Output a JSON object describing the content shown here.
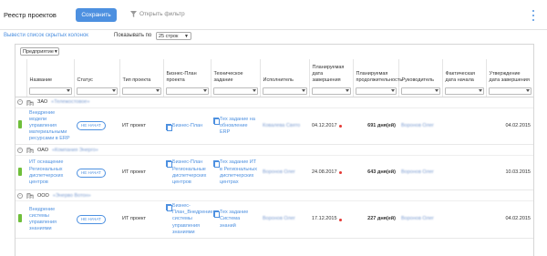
{
  "header": {
    "title": "Реестр проектов",
    "save_label": "Сохранить",
    "filter_label": "Открыть фильтр"
  },
  "controls": {
    "hidden_columns_link": "Вывести список скрытых колонок",
    "show_label": "Показывать по",
    "per_page_value": "25 строк",
    "company_filter": "Предприятие"
  },
  "columns": [
    "Название",
    "Статус",
    "Тип проекта",
    "Бизнес-План проекта",
    "Техническое задание",
    "Исполнитель",
    "Планируемая дата завершения",
    "Планируемая продолжительность",
    "Руководитель",
    "Фактическая дата начала",
    "Утверждение дата завершения"
  ],
  "groups": [
    {
      "org_type": "ЗАО",
      "org_name": "«Тележостовое»",
      "rows": [
        {
          "name": "Внедрение модели управления материальными ресурсами в ERP",
          "status": "НЕ НАЧАТ",
          "type": "ИТ проект",
          "bp": "Бизнес-План",
          "tz": "Тех задание на обновление ERP",
          "executor": "Ковалева Свято",
          "plan_end": "04.12.2017",
          "duration": "691 дня(ей)",
          "manager": "Воронов Олег",
          "fact_start": "",
          "approved_end": "04.02.2015"
        }
      ]
    },
    {
      "org_type": "ОАО",
      "org_name": "«Компания Энерго»",
      "rows": [
        {
          "name": "ИТ оснащение Региональных диспетчерских центров",
          "status": "НЕ НАЧАТ",
          "type": "ИТ проект",
          "bp": "Бизнес-План Региональные диспетчерских центров",
          "tz": "Тех задание ИТ в Региональных диспетчерских центрах",
          "executor": "Воронов Олег",
          "plan_end": "24.08.2017",
          "duration": "643 дня(ей)",
          "manager": "Воронов Олег",
          "fact_start": "",
          "approved_end": "10.03.2015"
        }
      ]
    },
    {
      "org_type": "ООО",
      "org_name": "«Энерво Вотон»",
      "rows": [
        {
          "name": "Внедрение системы управления знаниями",
          "status": "НЕ НАЧАТ",
          "type": "ИТ проект",
          "bp": "Бизнес-План_Внедрение системы управления знаниями",
          "tz": "Тех задание Система знаний",
          "executor": "Воронов Олег",
          "plan_end": "17.12.2015",
          "duration": "227 дня(ей)",
          "manager": "Воронов Олег",
          "fact_start": "",
          "approved_end": "04.02.2015"
        }
      ]
    }
  ],
  "colors": {
    "accent": "#4d90e0",
    "status_stripe": "#6fbf3a",
    "overdue_dot": "#e53935"
  }
}
